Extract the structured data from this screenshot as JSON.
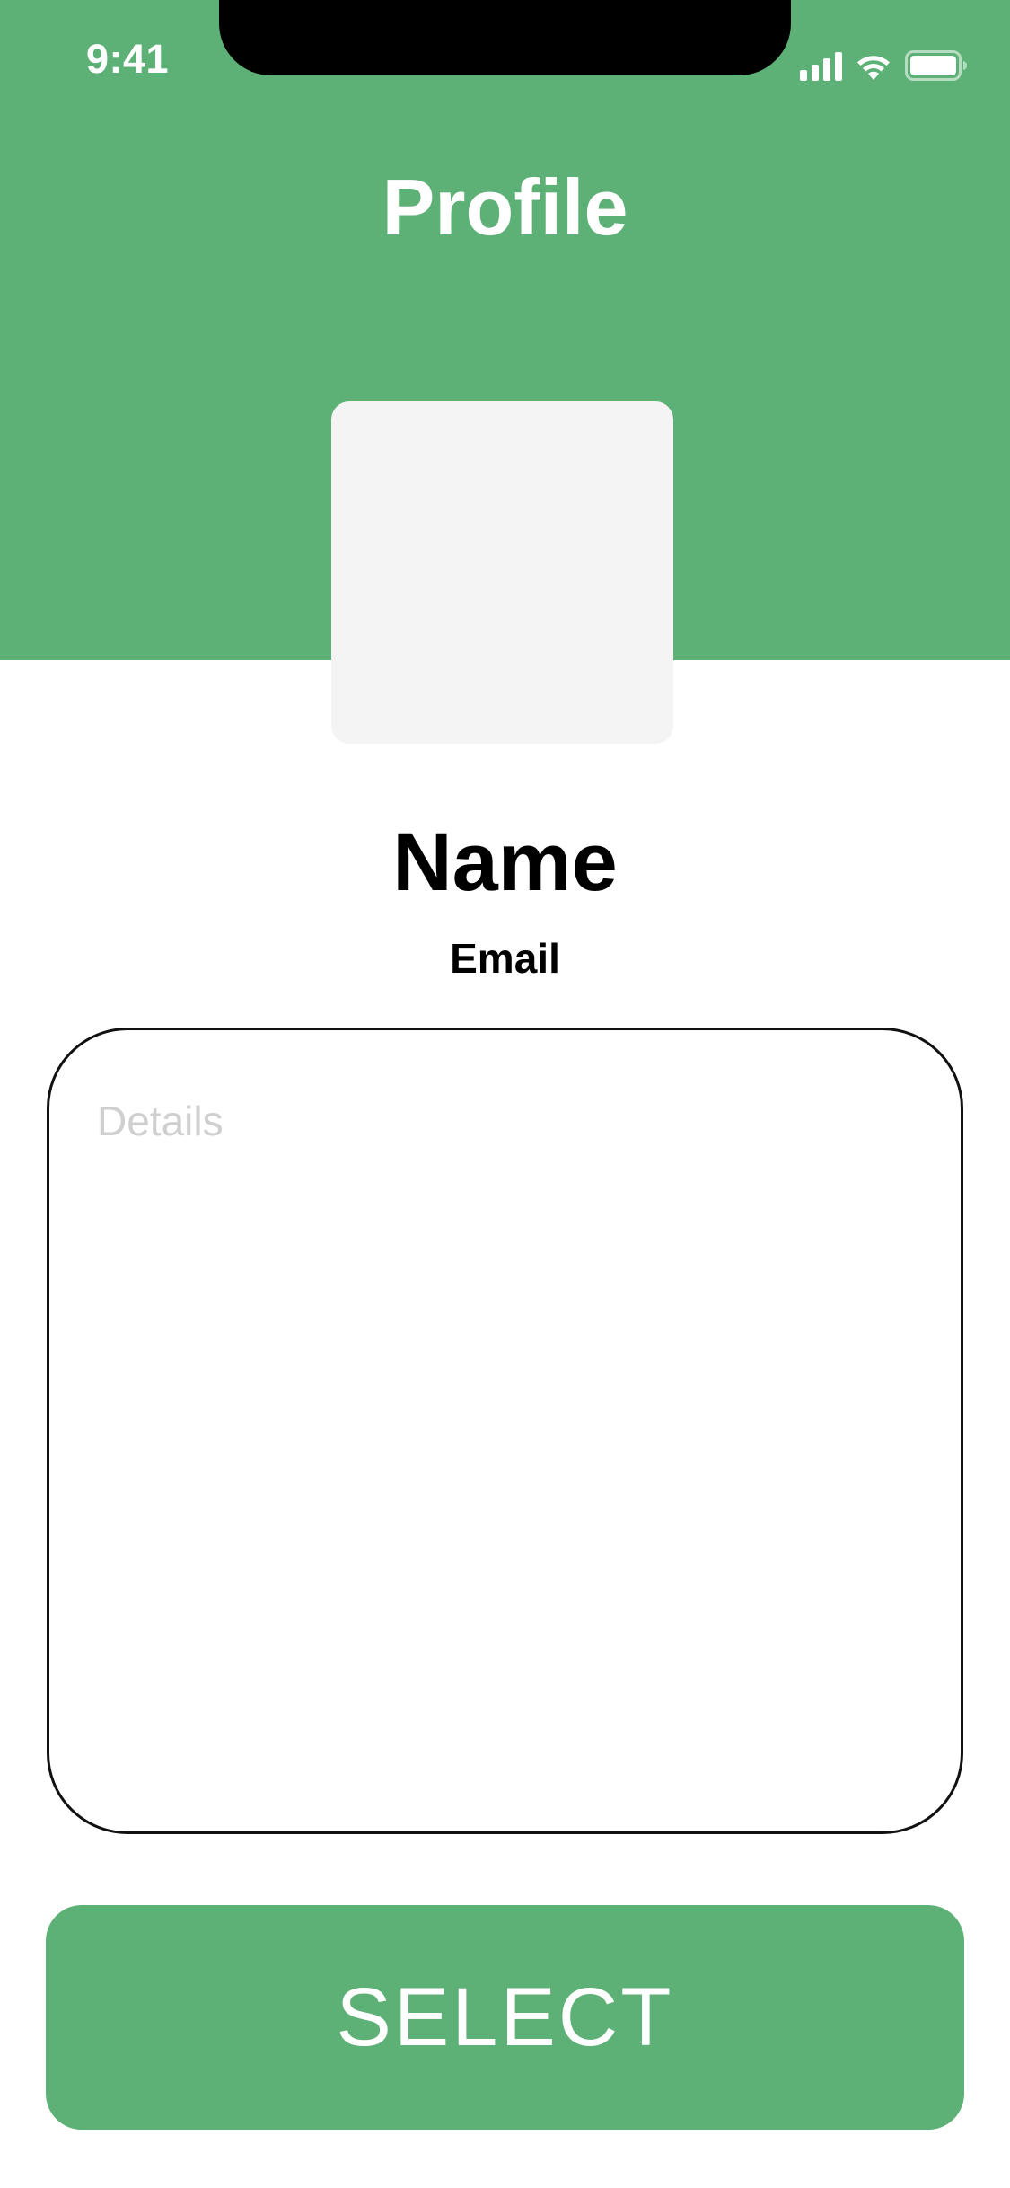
{
  "status_bar": {
    "time": "9:41",
    "icons": [
      "signal-icon",
      "wifi-icon",
      "battery-icon"
    ]
  },
  "header": {
    "title": "Profile",
    "background_color": "#5eb176"
  },
  "profile": {
    "avatar_icon": "avatar-placeholder",
    "name": "Name",
    "email": "Email"
  },
  "details": {
    "placeholder": "Details",
    "value": ""
  },
  "actions": {
    "select_label": "SELECT",
    "button_color": "#5eb176"
  }
}
